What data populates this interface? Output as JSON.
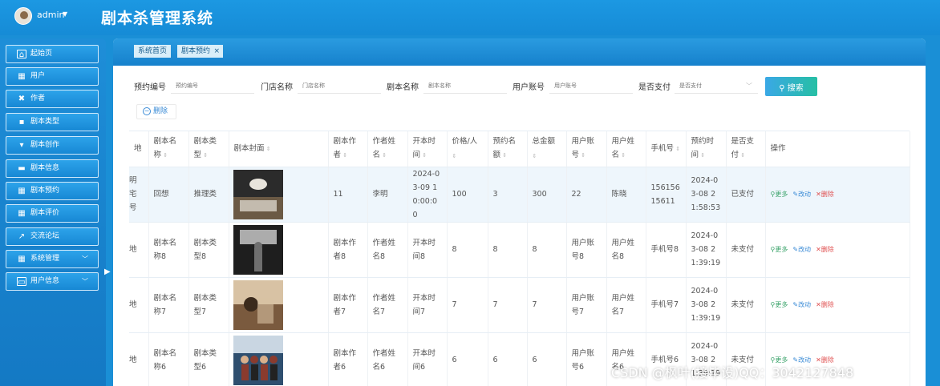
{
  "header": {
    "user": "admin",
    "title": "剧本杀管理系统"
  },
  "sidebar": {
    "items": [
      {
        "label": "起始页",
        "icon": "home-icon"
      },
      {
        "label": "用户",
        "icon": "grid-icon"
      },
      {
        "label": "作者",
        "icon": "tag-icon"
      },
      {
        "label": "剧本类型",
        "icon": "comment-icon"
      },
      {
        "label": "剧本创作",
        "icon": "pen-icon"
      },
      {
        "label": "剧本信息",
        "icon": "monitor-icon"
      },
      {
        "label": "剧本预约",
        "icon": "grid-icon"
      },
      {
        "label": "剧本评价",
        "icon": "grid-icon"
      },
      {
        "label": "交流论坛",
        "icon": "chart-icon"
      },
      {
        "label": "系统管理",
        "icon": "grid-icon",
        "expand": true
      },
      {
        "label": "用户信息",
        "icon": "card-icon",
        "expand": true
      }
    ]
  },
  "breadcrumb": {
    "home": "系统首页",
    "current": "剧本预约",
    "close": "×"
  },
  "search": {
    "fields": [
      {
        "label": "预约编号",
        "placeholder": "预约编号"
      },
      {
        "label": "门店名称",
        "placeholder": "门店名称"
      },
      {
        "label": "剧本名称",
        "placeholder": "剧本名称"
      },
      {
        "label": "用户账号",
        "placeholder": "用户账号"
      },
      {
        "label": "是否支付",
        "placeholder": "是否支付"
      }
    ],
    "button": "搜索"
  },
  "actions": {
    "delete": "删除"
  },
  "table": {
    "headers": [
      "剧本名称",
      "剧本类型",
      "剧本封面",
      "剧本作者",
      "作者姓名",
      "开本时间",
      "价格/人",
      "预约名额",
      "总金额",
      "用户账号",
      "用户姓名",
      "手机号",
      "预约时间",
      "是否支付",
      "操作"
    ],
    "truncated_header": "地",
    "ops": {
      "more": "更多",
      "edit": "改动",
      "delete": "删除"
    },
    "rows": [
      {
        "first": "明\n宅\n号",
        "name": "回想",
        "type": "推理类",
        "cover_style": "cafe",
        "author": "11",
        "author_name": "李明",
        "start": "2024-03-09 10:00:00",
        "price": "100",
        "seats": "3",
        "total": "300",
        "account": "22",
        "username": "陈晓",
        "phone": "15615615611",
        "time": "2024-03-08 21:58:53",
        "paid": "已支付"
      },
      {
        "first": "地",
        "name": "剧本名称8",
        "type": "剧本类型8",
        "cover_style": "dark",
        "author": "剧本作者8",
        "author_name": "作者姓名8",
        "start": "开本时间8",
        "price": "8",
        "seats": "8",
        "total": "8",
        "account": "用户账号8",
        "username": "用户姓名8",
        "phone": "手机号8",
        "time": "2024-03-08 21:39:19",
        "paid": "未支付"
      },
      {
        "first": "地",
        "name": "剧本名称7",
        "type": "剧本类型7",
        "cover_style": "warm",
        "author": "剧本作者7",
        "author_name": "作者姓名7",
        "start": "开本时间7",
        "price": "7",
        "seats": "7",
        "total": "7",
        "account": "用户账号7",
        "username": "用户姓名7",
        "phone": "手机号7",
        "time": "2024-03-08 21:39:19",
        "paid": "未支付"
      },
      {
        "first": "地",
        "name": "剧本名称6",
        "type": "剧本类型6",
        "cover_style": "group",
        "author": "剧本作者6",
        "author_name": "作者姓名6",
        "start": "开本时间6",
        "price": "6",
        "seats": "6",
        "total": "6",
        "account": "用户账号6",
        "username": "用户姓名6",
        "phone": "手机号6",
        "time": "2024-03-08 21:39:19",
        "paid": "未支付"
      }
    ]
  },
  "watermark": "CSDN @枫叶(接毕设)QQ：3042127848",
  "colors": {
    "topbar": "#1a8fd6",
    "search_button_from": "#3aa8e6",
    "search_button_to": "#26bfa4",
    "paid_link": "#3a8bd6",
    "more": "#3aa36a",
    "delete": "#e05050"
  }
}
